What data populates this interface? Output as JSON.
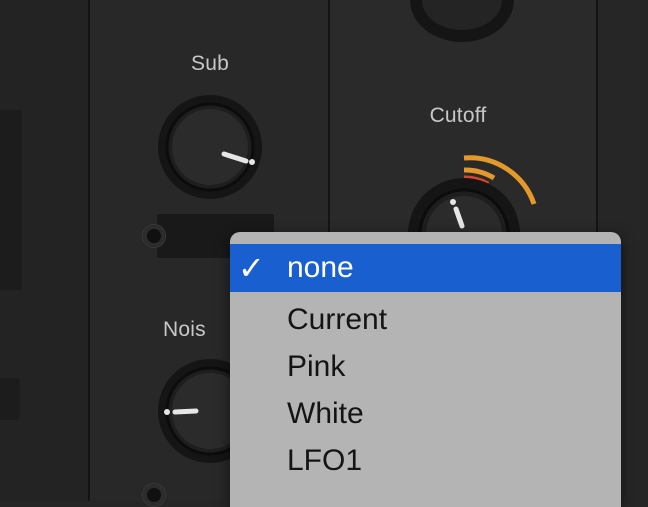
{
  "modules": {
    "sub_label": "Sub",
    "noise_label": "Nois",
    "cutoff_label": "Cutoff"
  },
  "menu": {
    "items": [
      {
        "label": "none",
        "selected": true
      },
      {
        "label": "Current",
        "selected": false
      },
      {
        "label": "Pink",
        "selected": false
      },
      {
        "label": "White",
        "selected": false
      },
      {
        "label": "LFO1",
        "selected": false
      }
    ],
    "check_glyph": "✓",
    "selected_color": "#1a5fd0"
  },
  "colors": {
    "cutoff_arc_orange": "#e49a2a",
    "cutoff_arc_red": "#d9452b"
  }
}
